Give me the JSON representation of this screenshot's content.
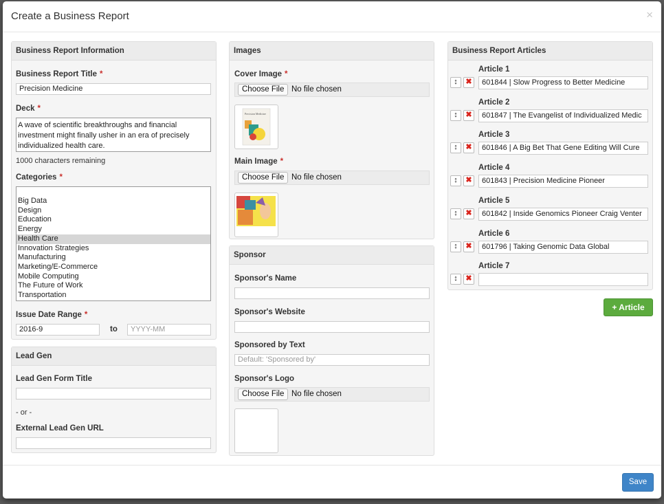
{
  "modal": {
    "title": "Create a Business Report",
    "close_symbol": "×"
  },
  "report_info": {
    "heading": "Business Report Information",
    "title_label": "Business Report Title",
    "title_value": "Precision Medicine",
    "deck_label": "Deck",
    "deck_value": "A wave of scientific breakthroughs and financial investment might finally usher in an era of precisely individualized health care.",
    "chars_remaining": "1000 characters remaining",
    "categories_label": "Categories",
    "categories": [
      "Big Data",
      "Design",
      "Education",
      "Energy",
      "Health Care",
      "Innovation Strategies",
      "Manufacturing",
      "Marketing/E-Commerce",
      "Mobile Computing",
      "The Future of Work",
      "Transportation"
    ],
    "selected_category": "Health Care",
    "date_range_label": "Issue Date Range",
    "date_from": "2016-9",
    "to_label": "to",
    "date_to_placeholder": "YYYY-MM",
    "required_marker": "*"
  },
  "lead_gen": {
    "heading": "Lead Gen",
    "form_title_label": "Lead Gen Form Title",
    "or_text": "- or -",
    "url_label": "External Lead Gen URL"
  },
  "images": {
    "heading": "Images",
    "cover_label": "Cover Image",
    "main_label": "Main Image",
    "choose_file": "Choose File",
    "no_file": "No file chosen",
    "cover_thumb_title": "Precision Medicine"
  },
  "sponsor": {
    "heading": "Sponsor",
    "name_label": "Sponsor's Name",
    "website_label": "Sponsor's Website",
    "sponsored_by_label": "Sponsored by Text",
    "sponsored_by_placeholder": "Default: 'Sponsored by'",
    "logo_label": "Sponsor's Logo"
  },
  "articles": {
    "heading": "Business Report Articles",
    "move_symbol": "↕",
    "delete_symbol": "✖",
    "items": [
      {
        "label": "Article 1",
        "value": "601844 | Slow Progress to Better Medicine"
      },
      {
        "label": "Article 2",
        "value": "601847 | The Evangelist of Individualized Medic"
      },
      {
        "label": "Article 3",
        "value": "601846 | A Big Bet That Gene Editing Will Cure"
      },
      {
        "label": "Article 4",
        "value": "601843 | Precision Medicine Pioneer"
      },
      {
        "label": "Article 5",
        "value": "601842 | Inside Genomics Pioneer Craig Venter"
      },
      {
        "label": "Article 6",
        "value": "601796 | Taking Genomic Data Global"
      },
      {
        "label": "Article 7",
        "value": ""
      }
    ],
    "add_label": "+ Article"
  },
  "footer": {
    "save_label": "Save"
  },
  "colors": {
    "primary": "#3f85c8",
    "success": "#5cab3e",
    "danger": "#d9241c",
    "selected": "#d6d6d6"
  }
}
